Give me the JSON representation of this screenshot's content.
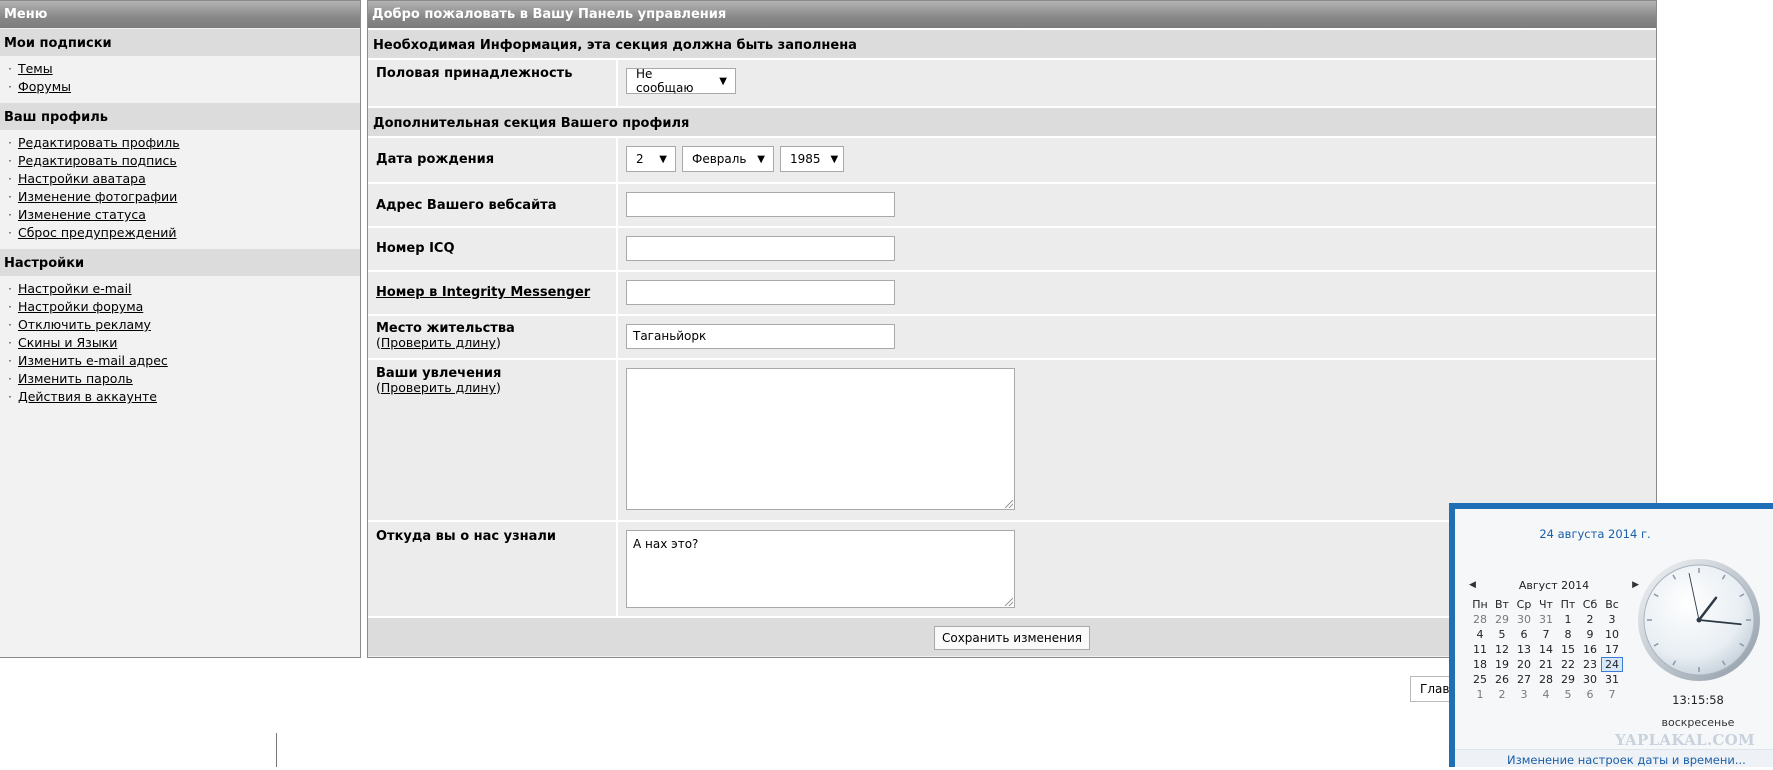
{
  "sidebar": {
    "header": "Меню",
    "sections": [
      {
        "title": "Мои подписки",
        "items": [
          "Темы",
          "Форумы"
        ]
      },
      {
        "title": "Ваш профиль",
        "items": [
          "Редактировать профиль",
          "Редактировать подпись",
          "Настройки аватара",
          "Изменение фотографии",
          "Изменение статуса",
          "Сброс предупреждений"
        ]
      },
      {
        "title": "Настройки",
        "items": [
          "Настройки e-mail",
          "Настройки форума",
          "Отключить рекламу",
          "Скины и Языки",
          "Изменить e-mail адрес",
          "Изменить пароль",
          "Действия в аккаунте"
        ]
      }
    ]
  },
  "main": {
    "header": "Добро пожаловать в Вашу Панель управления",
    "required_title": "Необходимая Информация, эта секция должна быть заполнена",
    "gender_label": "Половая принадлежность",
    "gender_value": "Не сообщаю",
    "extra_title": "Дополнительная секция Вашего профиля",
    "birth_label": "Дата рождения",
    "birth_day": "2",
    "birth_month": "Февраль",
    "birth_year": "1985",
    "website_label": "Адрес Вашего вебсайта",
    "website_value": "",
    "icq_label": "Номер ICQ",
    "icq_value": "",
    "integrity_label": "Номер в Integrity Messenger",
    "integrity_value": "",
    "location_label": "Место жительства",
    "location_check": "Проверить длину",
    "location_value": "Таганьйорк",
    "interests_label": "Ваши увлечения",
    "interests_check": "Проверить длину",
    "interests_value": "",
    "source_label": "Откуда вы о нас узнали",
    "source_value": "А нах это?",
    "save_label": "Сохранить изменения"
  },
  "footer": {
    "home_label": "Глав"
  },
  "clock": {
    "date_long": "24 августа 2014 г.",
    "month_label": "Август 2014",
    "weekdays": [
      "Пн",
      "Вт",
      "Ср",
      "Чт",
      "Пт",
      "Сб",
      "Вс"
    ],
    "weeks": [
      [
        {
          "d": "28",
          "dim": true
        },
        {
          "d": "29",
          "dim": true
        },
        {
          "d": "30",
          "dim": true
        },
        {
          "d": "31",
          "dim": true
        },
        {
          "d": "1"
        },
        {
          "d": "2"
        },
        {
          "d": "3"
        }
      ],
      [
        {
          "d": "4"
        },
        {
          "d": "5"
        },
        {
          "d": "6"
        },
        {
          "d": "7"
        },
        {
          "d": "8"
        },
        {
          "d": "9"
        },
        {
          "d": "10"
        }
      ],
      [
        {
          "d": "11"
        },
        {
          "d": "12"
        },
        {
          "d": "13"
        },
        {
          "d": "14"
        },
        {
          "d": "15"
        },
        {
          "d": "16"
        },
        {
          "d": "17"
        }
      ],
      [
        {
          "d": "18"
        },
        {
          "d": "19"
        },
        {
          "d": "20"
        },
        {
          "d": "21"
        },
        {
          "d": "22"
        },
        {
          "d": "23"
        },
        {
          "d": "24",
          "today": true
        }
      ],
      [
        {
          "d": "25"
        },
        {
          "d": "26"
        },
        {
          "d": "27"
        },
        {
          "d": "28"
        },
        {
          "d": "29"
        },
        {
          "d": "30"
        },
        {
          "d": "31"
        }
      ],
      [
        {
          "d": "1",
          "dim": true
        },
        {
          "d": "2",
          "dim": true
        },
        {
          "d": "3",
          "dim": true
        },
        {
          "d": "4",
          "dim": true
        },
        {
          "d": "5",
          "dim": true
        },
        {
          "d": "6",
          "dim": true
        },
        {
          "d": "7",
          "dim": true
        }
      ]
    ],
    "time": "13:15:58",
    "weekday_long": "воскресенье",
    "settings_link": "Изменение настроек даты и времени...",
    "watermark": "YAPLAKAL.COM",
    "accent": "#1e6fb5"
  }
}
